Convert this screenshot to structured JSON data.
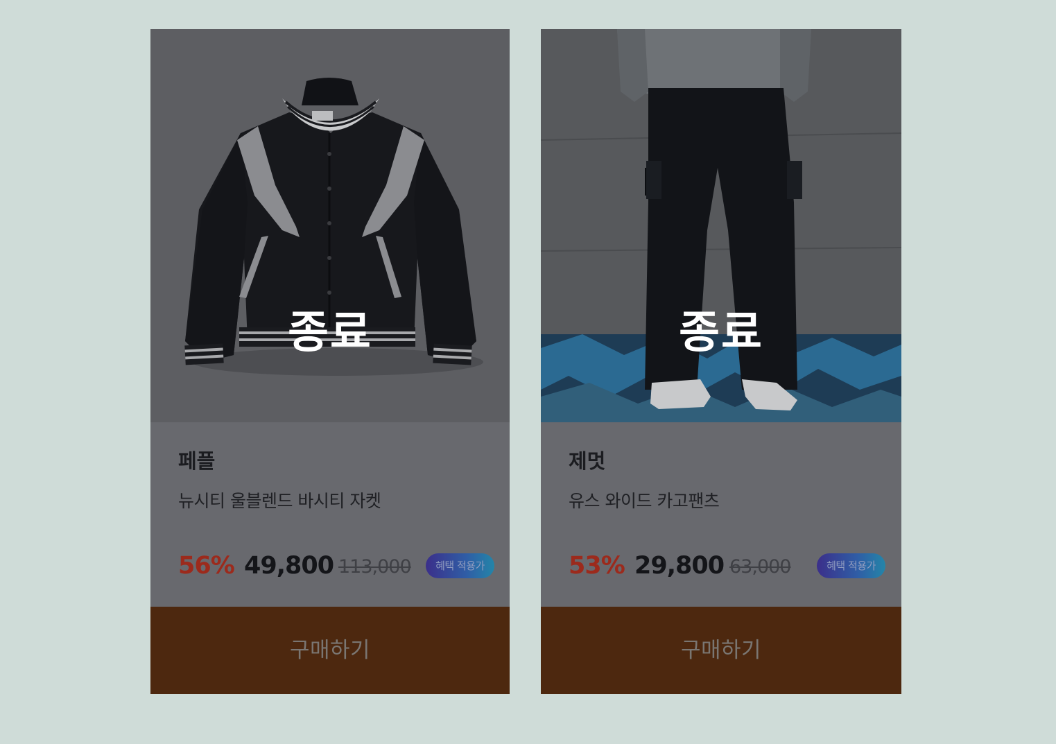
{
  "products": [
    {
      "status": "종료",
      "brand": "페플",
      "name": "뉴시티 울블렌드 바시티 자켓",
      "discount": "56%",
      "sale_price": "49,800",
      "original_price": "113,000",
      "badge": "혜택 적용가",
      "buy_label": "구매하기",
      "image": "varsity-jacket-photo"
    },
    {
      "status": "종료",
      "brand": "제멋",
      "name": "유스 와이드 카고팬츠",
      "discount": "53%",
      "sale_price": "29,800",
      "original_price": "63,000",
      "badge": "혜택 적용가",
      "buy_label": "구매하기",
      "image": "cargo-pants-photo"
    }
  ],
  "colors": {
    "page_background": "#cfdcd8",
    "overlay_card": "#68696e",
    "discount": "#9c2a1c",
    "buy_button": "#4d280f",
    "badge_gradient": [
      "#3b2f8a",
      "#2485a8"
    ]
  }
}
